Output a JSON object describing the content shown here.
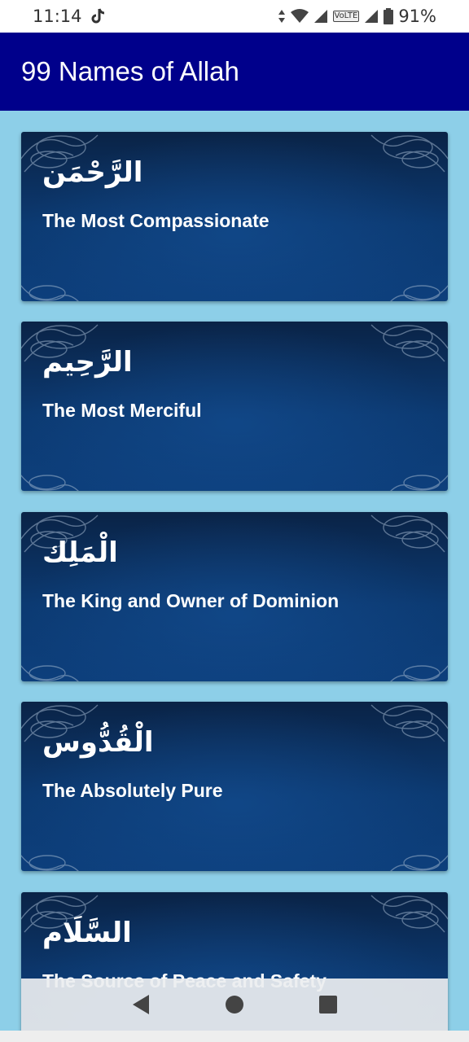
{
  "status_bar": {
    "time": "11:14",
    "volte": "VoLTE",
    "battery": "91%"
  },
  "app_bar": {
    "title": "99 Names of Allah"
  },
  "names": [
    {
      "arabic": "الرَّحْمَن",
      "meaning": "The Most Compassionate"
    },
    {
      "arabic": "الرَّحِيم",
      "meaning": "The Most Merciful"
    },
    {
      "arabic": "الْمَلِك",
      "meaning": "The King and Owner of Dominion"
    },
    {
      "arabic": "الْقُدُّوس",
      "meaning": "The Absolutely Pure"
    },
    {
      "arabic": "السَّلَام",
      "meaning": "The Source of Peace and Safety"
    }
  ],
  "icons": {
    "status_left": [
      "tiktok-icon"
    ],
    "status_right": [
      "data-arrows-icon",
      "wifi-icon",
      "signal-icon",
      "volte-icon",
      "signal-icon",
      "battery-icon"
    ],
    "navigation": [
      "back-icon",
      "home-icon",
      "recents-icon"
    ]
  },
  "colors": {
    "app_bar": "#00008b",
    "background": "#8dcfe8",
    "card": "#0c3a72",
    "text_on_card": "#ffffff"
  }
}
